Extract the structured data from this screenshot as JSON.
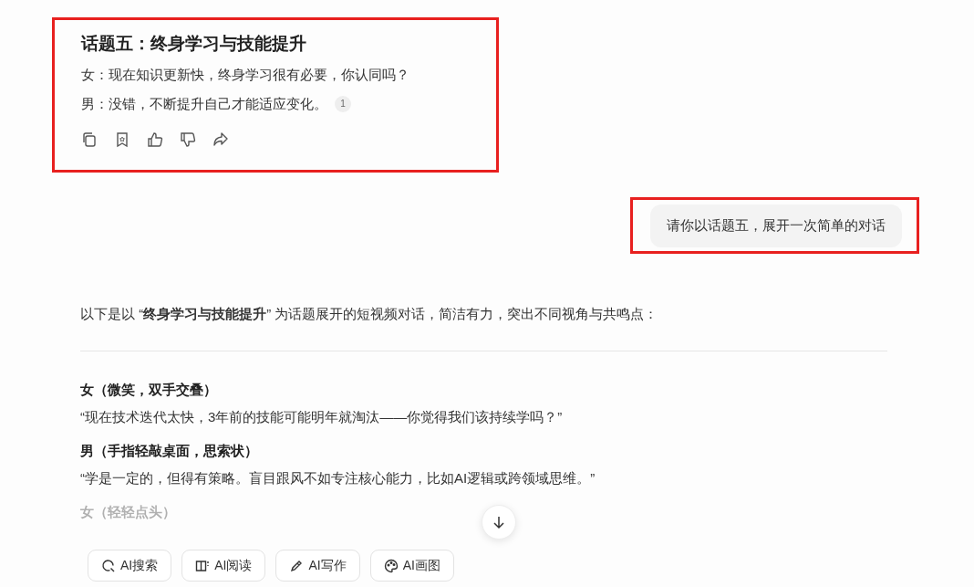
{
  "topic_card": {
    "title": "话题五：终身学习与技能提升",
    "lines": [
      "女：现在知识更新快，终身学习很有必要，你认同吗？",
      "男：没错，不断提升自己才能适应变化。"
    ],
    "citation": "1",
    "highlighted": true
  },
  "user_message": {
    "text": "请你以话题五，展开一次简单的对话",
    "highlighted": true
  },
  "reply": {
    "intro": "以下是以 “**终身学习与技能提升**” 为话题展开的短视频对话，简洁有力，突出不同视角与共鸣点：",
    "turns": [
      {
        "speaker": "女（微笑，双手交叠）",
        "line": "“现在技术迭代太快，3年前的技能可能明年就淘汰——你觉得我们该持续学吗？”",
        "faded": false
      },
      {
        "speaker": "男（手指轻敲桌面，思索状）",
        "line": "“学是一定的，但得有策略。盲目跟风不如专注核心能力，比如AI逻辑或跨领域思维。”",
        "faded": false
      },
      {
        "speaker": "女（轻轻点头）",
        "faded": true
      }
    ]
  },
  "tools": [
    {
      "label": "AI搜索",
      "kind": "search"
    },
    {
      "label": "AI阅读",
      "kind": "read"
    },
    {
      "label": "AI写作",
      "kind": "write"
    },
    {
      "label": "AI画图",
      "kind": "draw"
    }
  ]
}
